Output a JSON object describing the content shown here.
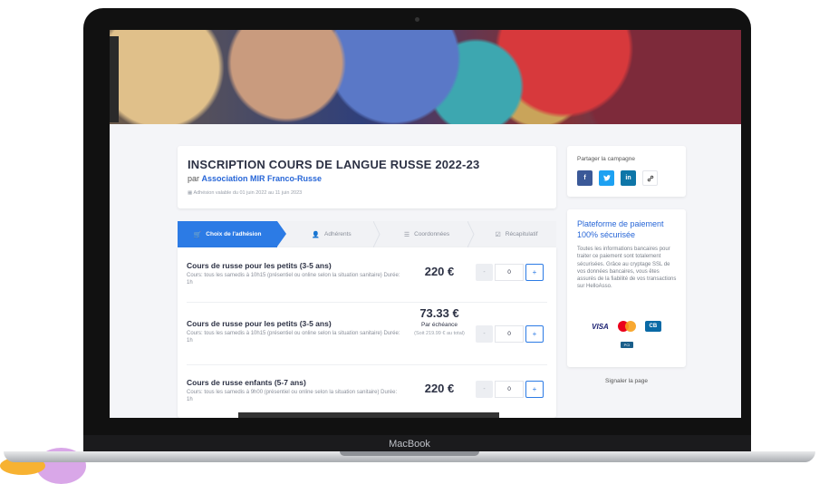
{
  "device": {
    "brand": "MacBook"
  },
  "header": {
    "title": "INSCRIPTION COURS DE LANGUE RUSSE 2022-23",
    "by_prefix": "par",
    "organization": "Association MIR Franco-Russe",
    "validity": "Adhésion valable du 01 juin 2022 au 11 juin 2023"
  },
  "steps": [
    {
      "label": "Choix de l'adhésion",
      "icon": "cart-icon",
      "active": true
    },
    {
      "label": "Adhérents",
      "icon": "user-icon"
    },
    {
      "label": "Coordonnées",
      "icon": "list-icon"
    },
    {
      "label": "Récapitulatif",
      "icon": "check-icon"
    }
  ],
  "items": [
    {
      "title": "Cours de russe pour les petits (3-5 ans)",
      "description": "Cours: tous les samedis à 10h15 (présentiel ou online selon la situation sanitaire) Durée: 1h",
      "price": "220 €",
      "quantity": "0"
    },
    {
      "title": "Cours de russe pour les petits (3-5 ans)",
      "description": "Cours: tous les samedis à 10h15 (présentiel ou online selon la situation sanitaire) Durée: 1h",
      "price": "73.33 €",
      "price_sub": "Par échéance",
      "price_note": "(Soit 219.99 € au total)",
      "quantity": "0"
    },
    {
      "title": "Cours de russe enfants (5-7 ans)",
      "description": "Cours: tous les samedis à 9h00 (présentiel ou online selon la situation sanitaire) Durée: 1h",
      "price": "220 €",
      "quantity": "0"
    }
  ],
  "stepper": {
    "minus": "-",
    "plus": "+"
  },
  "share": {
    "title": "Partager la campagne",
    "buttons": [
      {
        "label": "f",
        "icon": "facebook-icon"
      },
      {
        "label": "t",
        "icon": "twitter-icon"
      },
      {
        "label": "in",
        "icon": "linkedin-icon"
      },
      {
        "label": "🔗",
        "icon": "link-icon"
      }
    ]
  },
  "payment": {
    "title": "Plateforme de paiement 100% sécurisée",
    "description": "Toutes les informations bancaires pour traiter ce paiement sont totalement sécurisées. Grâce au cryptage SSL de vos données bancaires, vous êtes assurés de la fiabilité de vos transactions sur HelloAsso.",
    "logos": {
      "visa": "VISA",
      "cb": "CB",
      "secure": "PCI"
    }
  },
  "report_link": "Signaler la page",
  "colors": {
    "accent": "#2c7be5",
    "link": "#2766d7",
    "text": "#2c3144"
  }
}
